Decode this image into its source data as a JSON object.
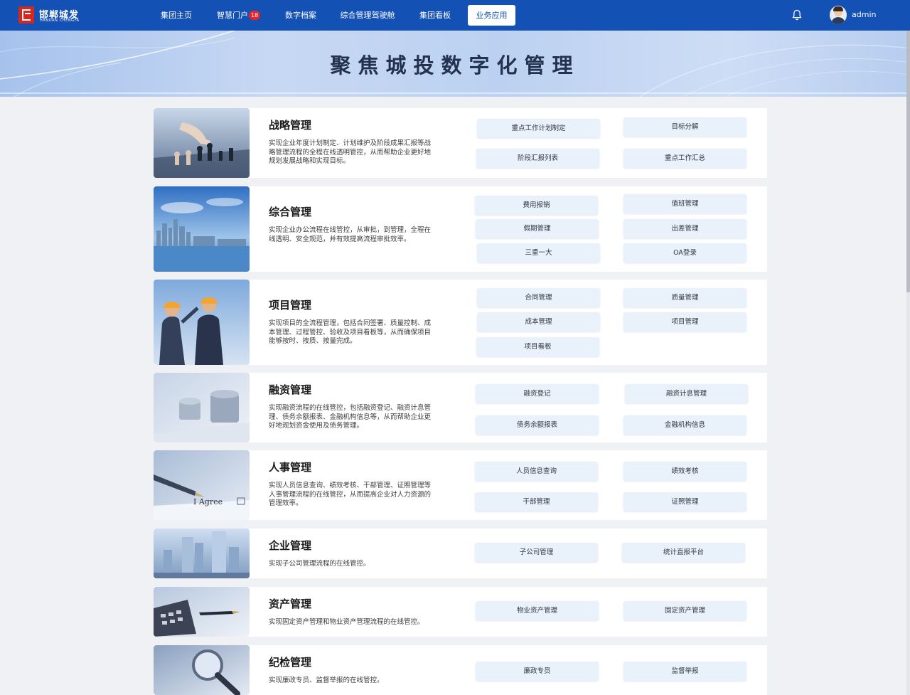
{
  "header": {
    "logo_cn": "邯郸城发",
    "logo_en": "HANDAN CHENGFA",
    "nav": [
      {
        "label": "集团主页"
      },
      {
        "label": "智慧门户",
        "badge": "18"
      },
      {
        "label": "数字档案"
      },
      {
        "label": "综合管理驾驶舱"
      },
      {
        "label": "集团看板"
      },
      {
        "label": "业务应用",
        "active": true
      }
    ],
    "username": "admin"
  },
  "banner": {
    "title": "聚焦城投数字化管理"
  },
  "modules": [
    {
      "title": "战略管理",
      "desc": "实现企业年度计划制定、计划维护及阶段成果汇报等战略管理流程的全程在线透明管控，从而帮助企业更好地规划发展战略和实现目标。",
      "items": [
        "重点工作计划制定",
        "目标分解",
        "阶段汇报列表",
        "重点工作汇总"
      ]
    },
    {
      "title": "综合管理",
      "desc": "实现企业办公流程在线管控，从审批，到管理，全程在线透明、安全规范，并有效提高流程审批效率。",
      "items": [
        "费用报销",
        "值班管理",
        "假期管理",
        "出差管理",
        "三重一大",
        "OA登录"
      ]
    },
    {
      "title": "项目管理",
      "desc": "实现项目的全流程管理，包括合同签署、质量控制、成本管理、过程管控、验收及项目看板等，从而确保项目能够按时、按质、按量完成。",
      "items": [
        "合同管理",
        "质量管理",
        "成本管理",
        "项目管理",
        "项目看板"
      ]
    },
    {
      "title": "融资管理",
      "desc": "实现融资流程的在线管控，包括融资登记、融资计息管理、债务余额报表、金融机构信息等，从而帮助企业更好地规划资金使用及债务管理。",
      "items": [
        "融资登记",
        "融资计息管理",
        "债务余额报表",
        "金融机构信息"
      ]
    },
    {
      "title": "人事管理",
      "desc": "实现人员信息查询、绩效考核、干部管理、证照管理等人事管理流程的在线管控，从而提高企业对人力资源的管理效率。",
      "items": [
        "人员信息查询",
        "绩效考核",
        "干部管理",
        "证照管理"
      ],
      "photo_text": "I Agree"
    },
    {
      "title": "企业管理",
      "desc": "实现子公司管理流程的在线管控。",
      "items": [
        "子公司管理",
        "统计直报平台"
      ]
    },
    {
      "title": "资产管理",
      "desc": "实现固定资产管理和物业资产管理流程的在线管控。",
      "items": [
        "物业资产管理",
        "固定资产管理"
      ]
    },
    {
      "title": "纪检管理",
      "desc": "实现廉政专员、监督举报的在线管控。",
      "items": [
        "廉政专员",
        "监督举报"
      ]
    }
  ],
  "colors": {
    "header_bg": "#1451b4",
    "badge": "#e5242b",
    "chip_bg": "#e9f1fb",
    "page_bg": "#eff1f4"
  },
  "icons": {
    "bell": "bell-icon",
    "avatar": "user-avatar"
  }
}
